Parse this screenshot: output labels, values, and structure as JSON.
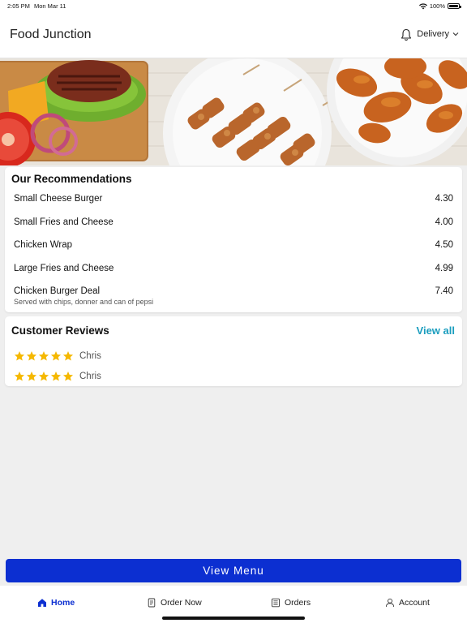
{
  "status_bar": {
    "time": "2:05 PM",
    "date": "Mon Mar 11",
    "battery": "100%"
  },
  "header": {
    "title": "Food Junction",
    "delivery_label": "Delivery",
    "icons": [
      "bell-icon",
      "chevron-down-icon",
      "wifi-icon",
      "battery-icon"
    ]
  },
  "hero": {
    "image": "food-banner-burger-kebab-wings"
  },
  "recommendations": {
    "title": "Our Recommendations",
    "items": [
      {
        "name": "Small Cheese Burger",
        "price": "4.30"
      },
      {
        "name": "Small Fries and Cheese",
        "price": "4.00"
      },
      {
        "name": "Chicken Wrap",
        "price": "4.50"
      },
      {
        "name": "Large Fries and Cheese",
        "price": "4.99"
      },
      {
        "name": "Chicken Burger Deal",
        "price": "7.40",
        "description": "Served with chips, donner and can of pepsi"
      }
    ]
  },
  "reviews": {
    "title": "Customer Reviews",
    "view_all_label": "View all",
    "items": [
      {
        "name": "Chris",
        "rating": 5
      },
      {
        "name": "Chris",
        "rating": 5
      }
    ]
  },
  "view_menu_label": "View Menu",
  "tabs": [
    {
      "label": "Home",
      "icon": "home-icon",
      "active": true
    },
    {
      "label": "Order Now",
      "icon": "order-icon",
      "active": false
    },
    {
      "label": "Orders",
      "icon": "orders-icon",
      "active": false
    },
    {
      "label": "Account",
      "icon": "account-icon",
      "active": false
    }
  ],
  "colors": {
    "primary": "#0c2fd1",
    "link": "#1a9dbe",
    "star": "#f5b800",
    "background": "#efefef"
  }
}
